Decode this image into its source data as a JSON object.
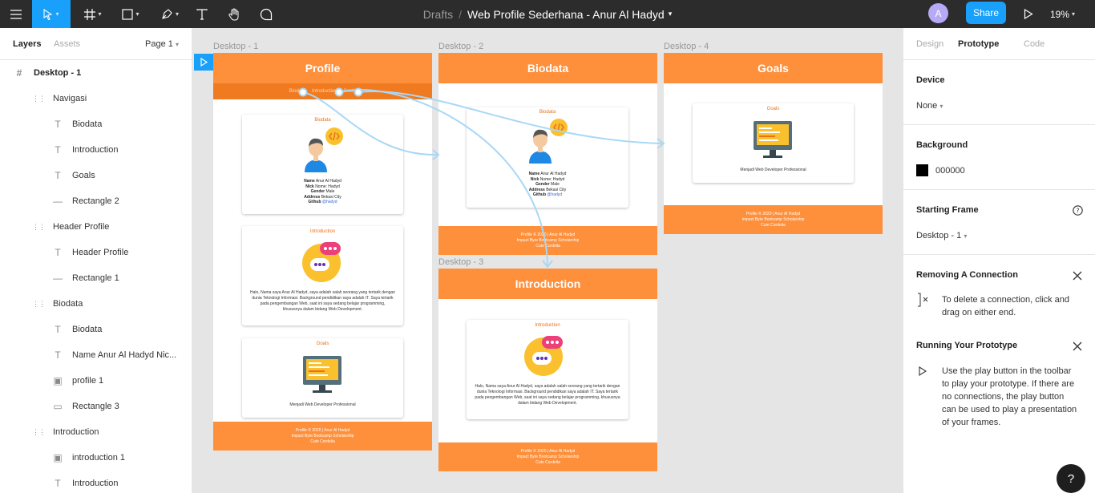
{
  "topbar": {
    "breadcrumb_drafts": "Drafts",
    "breadcrumb_sep": "/",
    "file_name": "Web Profile Sederhana - Anur Al Hadyd",
    "avatar_initial": "A",
    "share_label": "Share",
    "zoom_label": "19%"
  },
  "layers_panel": {
    "tab_layers": "Layers",
    "tab_assets": "Assets",
    "page_select": "Page 1",
    "items": [
      {
        "label": "Desktop - 1",
        "icon": "frame-hash-icon"
      },
      {
        "label": "Navigasi",
        "icon": "group-icon"
      },
      {
        "label": "Biodata",
        "icon": "text-icon"
      },
      {
        "label": "Introduction",
        "icon": "text-icon"
      },
      {
        "label": "Goals",
        "icon": "text-icon"
      },
      {
        "label": "Rectangle 2",
        "icon": "line-icon"
      },
      {
        "label": "Header Profile",
        "icon": "group-icon"
      },
      {
        "label": "Header Profile",
        "icon": "text-icon"
      },
      {
        "label": "Rectangle 1",
        "icon": "line-icon"
      },
      {
        "label": "Biodata",
        "icon": "group-icon"
      },
      {
        "label": "Biodata",
        "icon": "text-icon"
      },
      {
        "label": "Name Anur Al Hadyd Nic...",
        "icon": "text-icon"
      },
      {
        "label": "profile 1",
        "icon": "image-icon"
      },
      {
        "label": "Rectangle 3",
        "icon": "rectangle-icon"
      },
      {
        "label": "Introduction",
        "icon": "group-icon"
      },
      {
        "label": "introduction  1",
        "icon": "image-icon"
      },
      {
        "label": "Introduction",
        "icon": "text-icon"
      }
    ]
  },
  "canvas": {
    "frames": {
      "d1": {
        "label": "Desktop - 1",
        "header": "Profile",
        "nav": [
          "Biodata",
          "Introduction",
          "Goals"
        ],
        "bio_title": "Biodata",
        "intro_title": "Introduction",
        "goals_title": "Goals"
      },
      "d2": {
        "label": "Desktop - 2",
        "header": "Biodata",
        "bio_title": "Biodata"
      },
      "d3": {
        "label": "Desktop - 3",
        "header": "Introduction",
        "intro_title": "Introduction"
      },
      "d4": {
        "label": "Desktop - 4",
        "header": "Goals",
        "goals_title": "Goals"
      }
    },
    "bio": {
      "name_label": "Name",
      "name_value": "Anur Al Hadyd",
      "nick_label": "Nick",
      "nick_value": "Nome: Hadyd",
      "gender_label": "Gender",
      "gender_value": "Male",
      "address_label": "Address",
      "address_value": "Bekasi City",
      "github_label": "Github",
      "github_value": "@hadyd"
    },
    "intro_text": "Halo, Nama saya Anur Al Hadyd, saya adalah salah seorang yang tertarik dengan dunia Teknologi Informasi. Background pendidikan saya adalah IT. Saya tertarik pada pengembangan Web, saat ini saya sedang belajar programming, khususnya dalam bidang Web Development.",
    "goals_text": "Menjadi Web Developer Professional",
    "footer": {
      "line1": "Profile © 2020 | Anur Al Hadyd",
      "line2": "Impact Byte Bootcamp Scholarship",
      "line3": "Cute Cordelia"
    },
    "colors": {
      "orange": "#fe8f3b",
      "dark_orange": "#f07a1f",
      "connection": "#a9d8f5",
      "accent": "#18a0fb"
    }
  },
  "right_panel": {
    "tab_design": "Design",
    "tab_prototype": "Prototype",
    "tab_code": "Code",
    "device_title": "Device",
    "device_value": "None",
    "background_title": "Background",
    "background_value": "000000",
    "starting_frame_title": "Starting Frame",
    "starting_frame_value": "Desktop - 1",
    "removing_title": "Removing A Connection",
    "removing_text": "To delete a connection, click and drag on either end.",
    "running_title": "Running Your Prototype",
    "running_text": "Use the play button in the toolbar to play your prototype. If there are no connections, the play button can be used to play a presentation of your frames.",
    "help_label": "?"
  }
}
